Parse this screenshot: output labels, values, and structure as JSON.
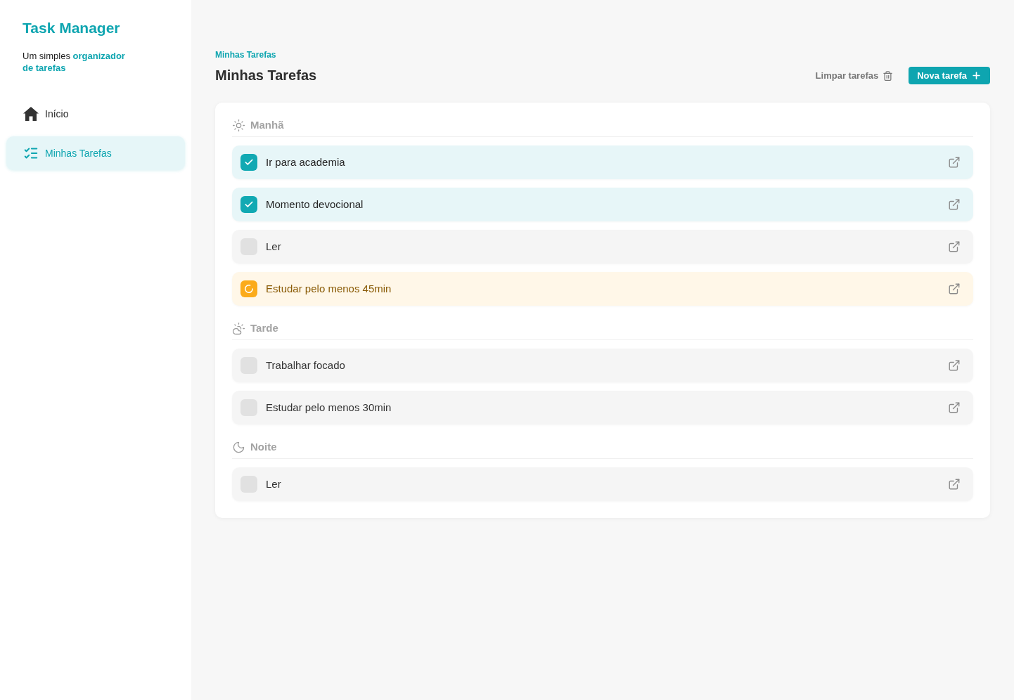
{
  "sidebar": {
    "title": "Task Manager",
    "tagline": "Um simples **organizador de tarefas**",
    "items": [
      {
        "label": "Início",
        "selected": false
      },
      {
        "label": "Minhas Tarefas",
        "selected": true
      }
    ]
  },
  "header": {
    "breadcrumb": "Minhas Tarefas",
    "title": "Minhas Tarefas",
    "actions": [
      {
        "label": "Limpar tarefas",
        "kind": "ghost"
      },
      {
        "label": "Nova tarefa",
        "kind": "primary"
      }
    ]
  },
  "sections": [
    {
      "title": "Manhã",
      "tasks": [
        {
          "label": "Ir para academia",
          "checked": true,
          "in_progress": false
        },
        {
          "label": "Momento devocional",
          "checked": true,
          "in_progress": false
        },
        {
          "label": "Ler",
          "checked": false,
          "in_progress": false
        },
        {
          "label": "Estudar pelo menos 45min",
          "checked": false,
          "in_progress": true
        }
      ]
    },
    {
      "title": "Tarde",
      "tasks": [
        {
          "label": "Trabalhar focado",
          "checked": false,
          "in_progress": false
        },
        {
          "label": "Estudar pelo menos 30min",
          "checked": false,
          "in_progress": false
        }
      ]
    },
    {
      "title": "Noite",
      "tasks": [
        {
          "label": "Ler",
          "checked": false,
          "in_progress": false
        }
      ]
    }
  ]
}
